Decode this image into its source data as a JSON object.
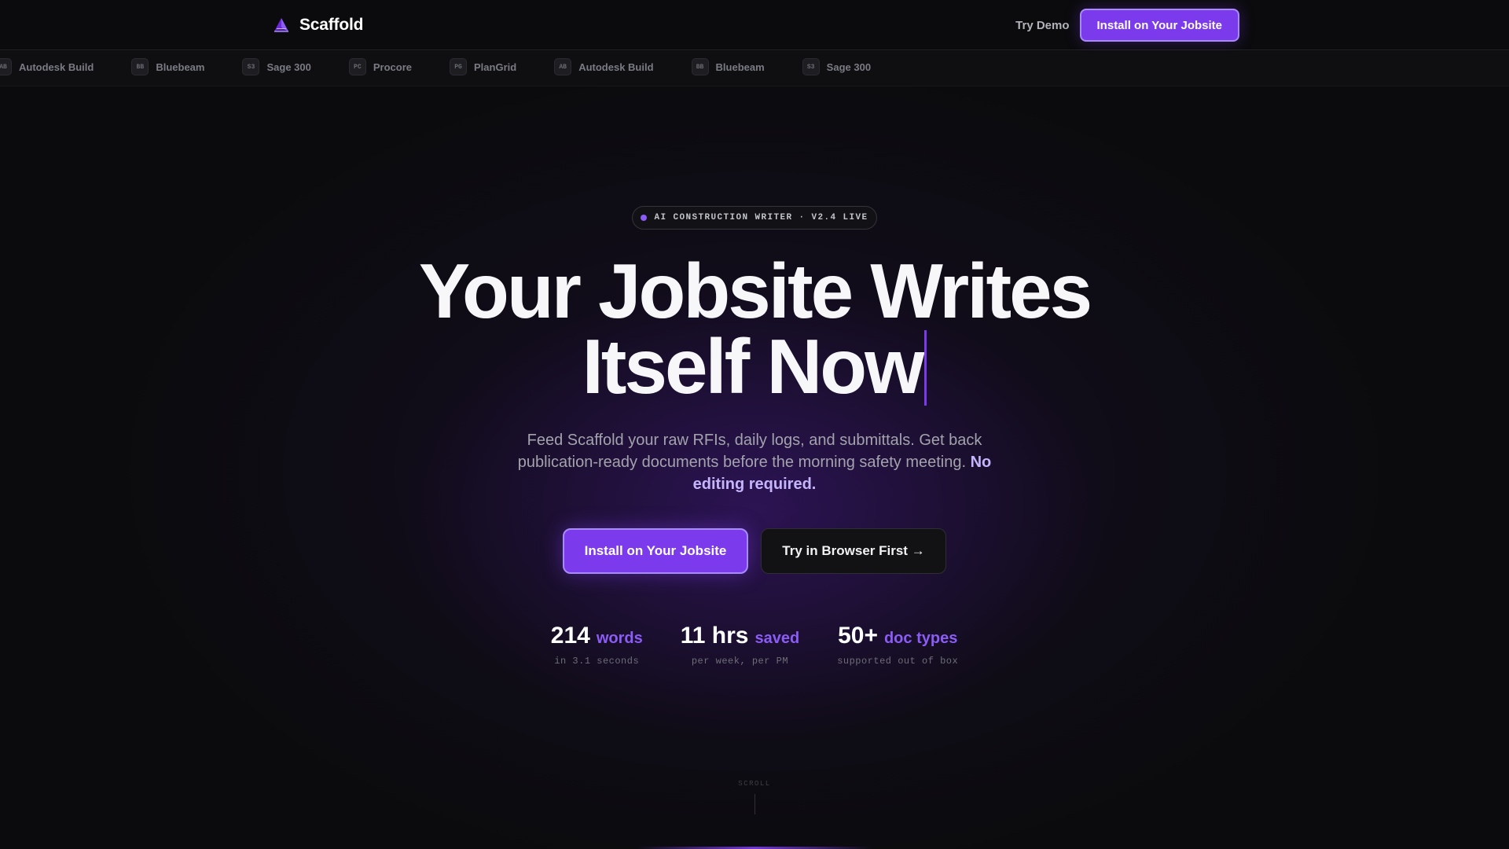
{
  "header": {
    "brand_name": "Scaffold",
    "brand_icon": "scaffold-triangle-icon",
    "try_demo": "Try Demo",
    "install": "Install on Your Jobsite"
  },
  "integrations": [
    {
      "abbr": "AB",
      "name": "Autodesk Build"
    },
    {
      "abbr": "BB",
      "name": "Bluebeam"
    },
    {
      "abbr": "S3",
      "name": "Sage 300"
    },
    {
      "abbr": "PC",
      "name": "Procore"
    },
    {
      "abbr": "PG",
      "name": "PlanGrid"
    },
    {
      "abbr": "AB",
      "name": "Autodesk Build"
    },
    {
      "abbr": "BB",
      "name": "Bluebeam"
    },
    {
      "abbr": "S3",
      "name": "Sage 300"
    }
  ],
  "hero": {
    "pill": "AI CONSTRUCTION WRITER · V2.4 LIVE",
    "headline_line1": "Your Jobsite Writes",
    "headline_line2": "Itself Now",
    "sub_text": "Feed Scaffold your raw RFIs, daily logs, and submittals. Get back publication-ready documents before the morning safety meeting.",
    "sub_emphasis": "No editing required.",
    "cta_primary": "Install on Your Jobsite",
    "cta_secondary": "Try in Browser First →"
  },
  "stats": [
    {
      "value": "214",
      "unit": "words",
      "caption": "in 3.1 seconds"
    },
    {
      "value": "11 hrs",
      "unit": "saved",
      "caption": "per week, per PM"
    },
    {
      "value": "50+",
      "unit": "doc types",
      "caption": "supported out of box"
    }
  ],
  "scroll_label": "SCROLL",
  "colors": {
    "accent": "#7c3aed",
    "accent_light": "#a78bfa",
    "background": "#0b0b0d"
  }
}
